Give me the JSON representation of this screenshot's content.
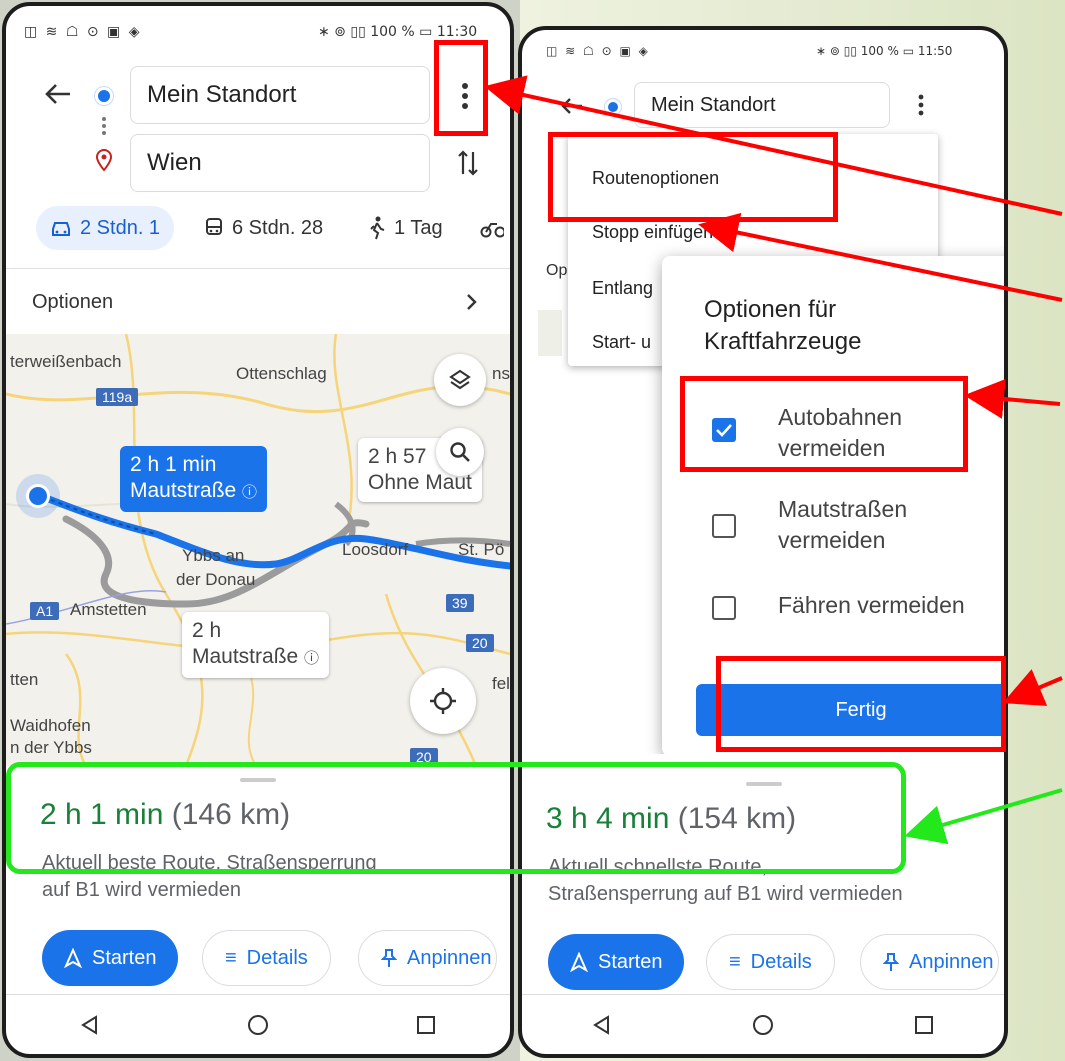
{
  "left": {
    "status_icons": "◫ ≋ ☖ ⊙ ▣ ◈",
    "status_right": "∗ ⊚ ▯▯ 100 % ▭ 11:30",
    "origin": "Mein Standort",
    "destination": "Wien",
    "modes": [
      {
        "icon": "car-icon",
        "label": "2 Stdn. 1"
      },
      {
        "icon": "transit-icon",
        "label": "6 Stdn. 28"
      },
      {
        "icon": "walk-icon",
        "label": "1 Tag"
      }
    ],
    "options_label": "Optionen",
    "map": {
      "labels": [
        {
          "text": "terweißenbach"
        },
        {
          "text": "Ottenschlag"
        },
        {
          "text": "Ybbs an"
        },
        {
          "text": "der Donau"
        },
        {
          "text": "Amstetten"
        },
        {
          "text": "Loosdorf"
        },
        {
          "text": "St. Pö"
        },
        {
          "text": "tten"
        },
        {
          "text": "Waidhofen"
        },
        {
          "text": "n der Ybbs"
        },
        {
          "text": "ns"
        },
        {
          "text": "fel"
        }
      ],
      "road_shields": [
        "119a",
        "A1",
        "39",
        "20",
        "20"
      ],
      "bubble_main": {
        "line1": "2 h 1 min",
        "line2": "Mautstraße"
      },
      "bubble_alt1": {
        "line1": "2 h 57",
        "line2": "Ohne Maut"
      },
      "bubble_alt2": {
        "line1": "2 h",
        "line2": "Mautstraße"
      }
    },
    "route_time": "2 h 1 min",
    "route_km": "(146 km)",
    "route_desc_1": "Aktuell beste Route, Straßensperrung",
    "route_desc_2": "auf B1 wird vermieden",
    "btn_start": "Starten",
    "btn_details": "Details",
    "btn_pin": "Anpinnen"
  },
  "right": {
    "status_icons": "◫ ≋ ☖ ⊙ ▣ ◈",
    "status_right": "∗ ⊚ ▯▯ 100 % ▭ 11:50",
    "origin": "Mein Standort",
    "menu_items": [
      "Routenoptionen",
      "Stopp einfügen",
      "Entlang",
      "Start- u"
    ],
    "options_partial": "Op",
    "dialog": {
      "title_1": "Optionen für",
      "title_2": "Kraftfahrzeuge",
      "options": [
        {
          "line1": "Autobahnen",
          "line2": "vermeiden",
          "checked": true
        },
        {
          "line1": "Mautstraßen",
          "line2": "vermeiden",
          "checked": false
        },
        {
          "line1": "Fähren vermeiden",
          "line2": "",
          "checked": false
        }
      ],
      "done_label": "Fertig"
    },
    "route_time": "3 h 4 min",
    "route_km": "(154 km)",
    "route_desc_1": "Aktuell schnellste Route,",
    "route_desc_2": "Straßensperrung auf B1 wird vermieden",
    "btn_start": "Starten",
    "btn_details": "Details",
    "btn_pin": "Anpinnen"
  },
  "colors": {
    "accent": "#1a73e8",
    "highlight_red": "#ff0000",
    "highlight_green": "#22e81c",
    "time_green": "#188038"
  }
}
